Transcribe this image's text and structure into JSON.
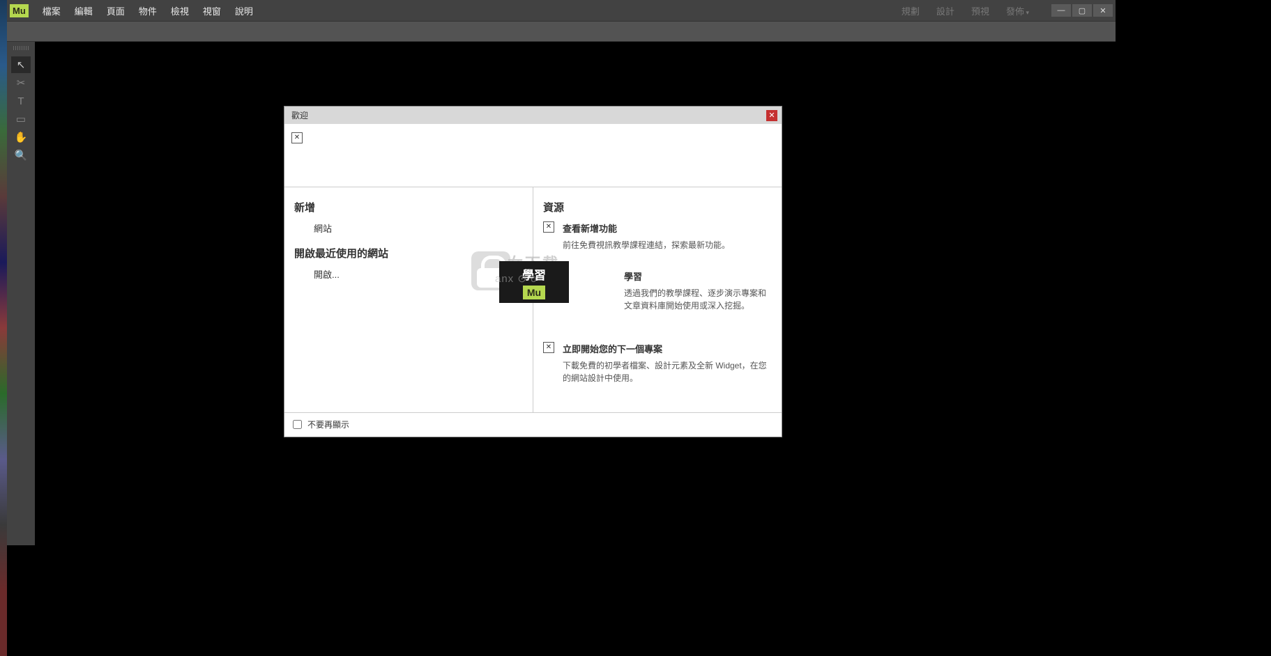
{
  "app": {
    "logo": "Mu"
  },
  "menus": {
    "file": "檔案",
    "edit": "編輯",
    "page": "頁面",
    "object": "物件",
    "view": "檢視",
    "window": "視窗",
    "help": "說明"
  },
  "modes": {
    "plan": "規劃",
    "design": "設計",
    "preview": "預視",
    "publish": "發佈"
  },
  "welcome": {
    "title": "歡迎",
    "create_heading": "新增",
    "create_site": "網站",
    "recent_heading": "開啟最近使用的網站",
    "open": "開啟...",
    "resources_heading": "資源",
    "res1_title": "查看新增功能",
    "res1_desc": "前往免費視訊教學課程連結，探索最新功能。",
    "res2_title": "學習",
    "res2_desc": "透過我們的教學課程、逐步演示專案和文章資料庫開始使用或深入挖掘。",
    "res3_title": "立即開始您的下一個專案",
    "res3_desc": "下載免費的初學者檔案、設計元素及全新 Widget，在您的網站設計中使用。",
    "dont_show": "不要再顯示"
  },
  "watermark": {
    "learn": "學習",
    "mu": "Mu",
    "brand1": "女下载",
    "brand2": "anx ⊙ o"
  }
}
